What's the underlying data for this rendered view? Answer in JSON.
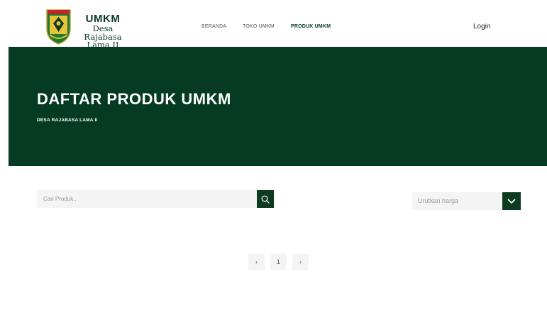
{
  "brand": {
    "line1": "UMKM",
    "line2": "Desa Rajabasa",
    "line3": "Lama II"
  },
  "nav": {
    "items": [
      {
        "label": "BERANDA",
        "active": false
      },
      {
        "label": "TOKO UMKM",
        "active": false
      },
      {
        "label": "PRODUK UMKM",
        "active": true
      }
    ],
    "login": "Login"
  },
  "banner": {
    "title": "DAFTAR PRODUK UMKM",
    "subtitle": "DESA RAJABASA LAMA II"
  },
  "search": {
    "placeholder": "Cari Produk..",
    "icon": "search-icon"
  },
  "sort": {
    "placeholder": "Urutkan harga",
    "icon": "chevron-down-icon"
  },
  "pagination": {
    "prev": "‹",
    "current": "1",
    "next": "›"
  },
  "colors": {
    "primary": "#0c3b22",
    "banner": "#043b22",
    "field_bg": "#f4f4f4"
  }
}
